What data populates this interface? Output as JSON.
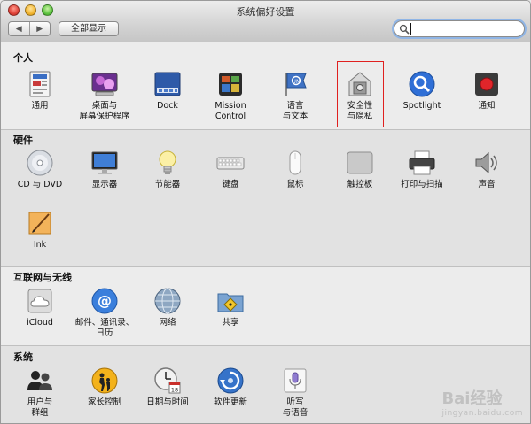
{
  "window": {
    "title": "系统偏好设置"
  },
  "toolbar": {
    "back_glyph": "◀",
    "forward_glyph": "▶",
    "show_all_label": "全部显示",
    "search_placeholder": "",
    "search_value": ""
  },
  "sections": {
    "personal": {
      "title": "个人",
      "items": [
        {
          "label": "通用",
          "icon": "general-icon"
        },
        {
          "label": "桌面与\n屏幕保护程序",
          "icon": "desktop-icon"
        },
        {
          "label": "Dock",
          "icon": "dock-icon"
        },
        {
          "label": "Mission\nControl",
          "icon": "mission-control-icon"
        },
        {
          "label": "语言\n与文本",
          "icon": "language-icon"
        },
        {
          "label": "安全性\n与隐私",
          "icon": "security-icon"
        },
        {
          "label": "Spotlight",
          "icon": "spotlight-icon"
        },
        {
          "label": "通知",
          "icon": "notifications-icon"
        }
      ]
    },
    "hardware": {
      "title": "硬件",
      "items": [
        {
          "label": "CD 与 DVD",
          "icon": "cd-dvd-icon"
        },
        {
          "label": "显示器",
          "icon": "display-icon"
        },
        {
          "label": "节能器",
          "icon": "energy-saver-icon"
        },
        {
          "label": "键盘",
          "icon": "keyboard-icon"
        },
        {
          "label": "鼠标",
          "icon": "mouse-icon"
        },
        {
          "label": "触控板",
          "icon": "trackpad-icon"
        },
        {
          "label": "打印与扫描",
          "icon": "printer-icon"
        },
        {
          "label": "声音",
          "icon": "sound-icon"
        },
        {
          "label": "Ink",
          "icon": "ink-icon"
        }
      ]
    },
    "internet": {
      "title": "互联网与无线",
      "items": [
        {
          "label": "iCloud",
          "icon": "icloud-icon"
        },
        {
          "label": "邮件、通讯录、\n日历",
          "icon": "mail-icon"
        },
        {
          "label": "网络",
          "icon": "network-icon"
        },
        {
          "label": "共享",
          "icon": "sharing-icon"
        }
      ]
    },
    "system": {
      "title": "系统",
      "items": [
        {
          "label": "用户与\n群组",
          "icon": "users-icon"
        },
        {
          "label": "家长控制",
          "icon": "parental-controls-icon"
        },
        {
          "label": "日期与时间",
          "icon": "date-time-icon"
        },
        {
          "label": "软件更新",
          "icon": "software-update-icon"
        },
        {
          "label": "听写\n与语音",
          "icon": "dictation-icon"
        }
      ]
    }
  },
  "date_icon_day": "18",
  "watermark": {
    "brand": "Bai经验",
    "url": "jingyan.baidu.com"
  },
  "colors": {
    "highlight": "#e0201f",
    "search_focus": "#8fb5e6"
  }
}
